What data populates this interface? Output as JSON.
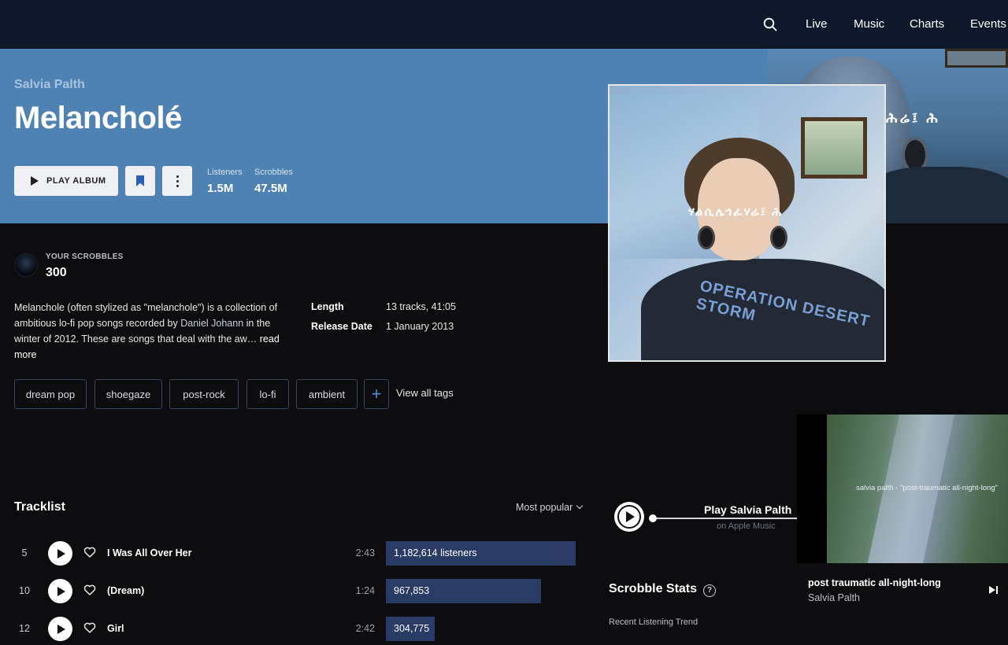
{
  "nav": {
    "links": [
      "Live",
      "Music",
      "Charts",
      "Events"
    ]
  },
  "album": {
    "artist": "Salvia Palth",
    "title": "Melancholé",
    "play_label": "PLAY ALBUM",
    "stats": [
      {
        "label": "Listeners",
        "value": "1.5M"
      },
      {
        "label": "Scrobbles",
        "value": "47.5M"
      }
    ],
    "cover_text": "ሃልሲሌኅፈሃሬ፤ ሕ",
    "cover_shirt_text": "OPERATION DESERT STORM"
  },
  "your_scrobbles": {
    "label": "YOUR SCROBBLES",
    "value": "300"
  },
  "description": {
    "text_1": "Melanchole (often stylized as \"melanchole\") is a collection of ambitious lo-fi pop songs recorded by ",
    "link": "Daniel Johann",
    "text_2": " in the winter of 2012. These are songs that deal with the aw… ",
    "read_more": "read more"
  },
  "metadata": [
    {
      "key": "Length",
      "value": "13 tracks, 41:05"
    },
    {
      "key": "Release Date",
      "value": "1 January 2013"
    }
  ],
  "tags": [
    "dream pop",
    "shoegaze",
    "post-rock",
    "lo-fi",
    "ambient"
  ],
  "view_all_tags": "View all tags",
  "tracklist": {
    "title": "Tracklist",
    "sort": "Most popular",
    "tracks": [
      {
        "num": "5",
        "name": "I Was All Over Her",
        "duration": "2:43",
        "listeners": "1,182,614 listeners",
        "share": 1.0
      },
      {
        "num": "10",
        "name": "(Dream)",
        "duration": "1:24",
        "listeners": "967,853",
        "share": 0.818
      },
      {
        "num": "12",
        "name": "Girl",
        "duration": "2:42",
        "listeners": "304,775",
        "share": 0.258
      }
    ]
  },
  "apple_music": {
    "title": "Play Salvia Palth",
    "subtitle": "on Apple Music"
  },
  "now_playing": {
    "video_caption": "salvia palth - \"post-traumatic all-night-long\"",
    "title": "post traumatic all-night-long",
    "artist": "Salvia Palth"
  },
  "stats_section": {
    "title": "Scrobble Stats",
    "trend_label": "Recent Listening Trend"
  },
  "colors": {
    "nav_bg": "#10192c",
    "hero_bg": "#4e82b2",
    "page_bg": "#0d0d0f",
    "accent": "#2e5fb5",
    "bar": "#2a3b66"
  }
}
